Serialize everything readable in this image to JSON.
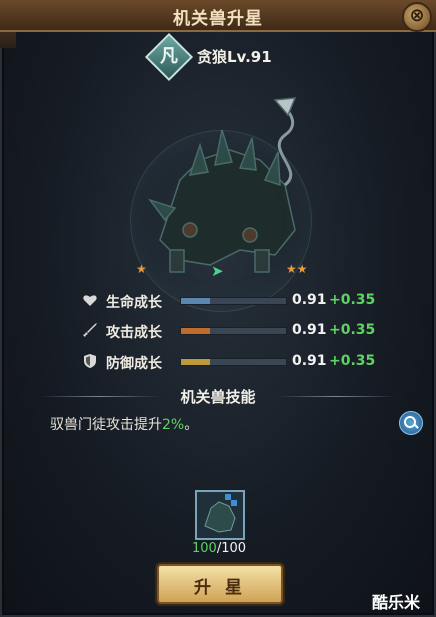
{
  "header": {
    "title": "机关兽升星",
    "close_label": "⊗"
  },
  "beast": {
    "rank_char": "凡",
    "name": "贪狼Lv.91",
    "stars_current": "★",
    "stars_next": "★★",
    "arrow": "➤"
  },
  "stats": [
    {
      "label": "生命成长",
      "value": "0.91",
      "plus": "+0.35",
      "icon": "heart-icon",
      "fill_fraction": 0.28,
      "color": "#5a86b0"
    },
    {
      "label": "攻击成长",
      "value": "0.91",
      "plus": "+0.35",
      "icon": "sword-icon",
      "fill_fraction": 0.28,
      "color": "#c06c2c"
    },
    {
      "label": "防御成长",
      "value": "0.91",
      "plus": "+0.35",
      "icon": "shield-icon",
      "fill_fraction": 0.28,
      "color": "#c09a3a"
    }
  ],
  "skill": {
    "title": "机关兽技能",
    "desc_prefix": "驭兽门徒攻击提升",
    "desc_pct": "2%",
    "desc_suffix": "。"
  },
  "material": {
    "have": "100",
    "need": "/100"
  },
  "action": {
    "label": "升 星"
  },
  "watermark": "酷乐米"
}
